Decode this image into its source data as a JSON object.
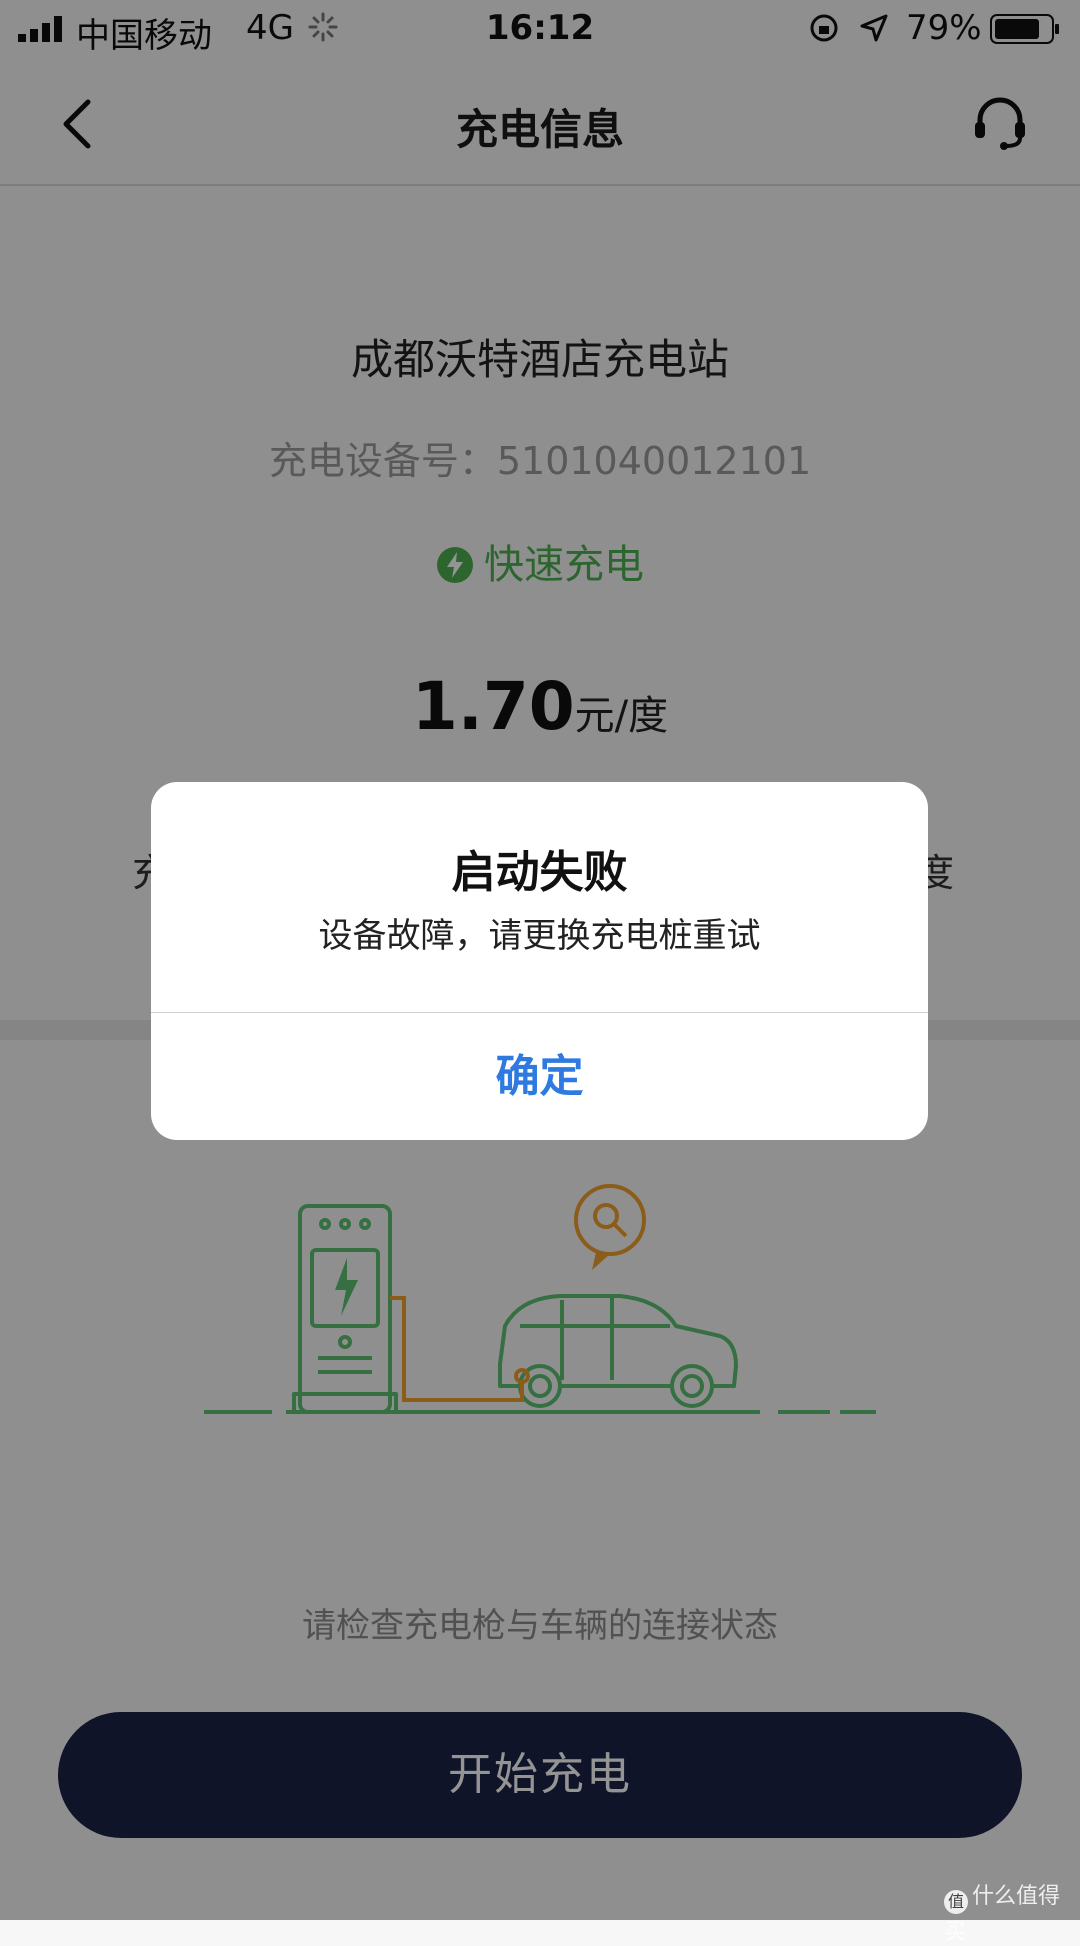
{
  "status_bar": {
    "carrier": "中国移动",
    "network": "4G",
    "time": "16:12",
    "battery": "79%"
  },
  "navbar": {
    "title": "充电信息",
    "back_icon": "chevron-left-icon",
    "service_icon": "headset-icon"
  },
  "station": {
    "name": "成都沃特酒店充电站",
    "device_label": "充电设备号：",
    "device_number": "5101040012101",
    "charge_type": "快速充电",
    "price": "1.70",
    "price_unit": "元/度",
    "partial_left": "充",
    "partial_right": "度"
  },
  "hint": "请检查充电枪与车辆的连接状态",
  "start_button": "开始充电",
  "dialog": {
    "title": "启动失败",
    "message": "设备故障，请更换充电桩重试",
    "confirm": "确定"
  },
  "watermark": "什么值得买",
  "colors": {
    "accent_green": "#4caf50",
    "dialog_blue": "#2f7ae0",
    "button_navy": "#1d2348",
    "illustration_orange": "#f0a030"
  }
}
